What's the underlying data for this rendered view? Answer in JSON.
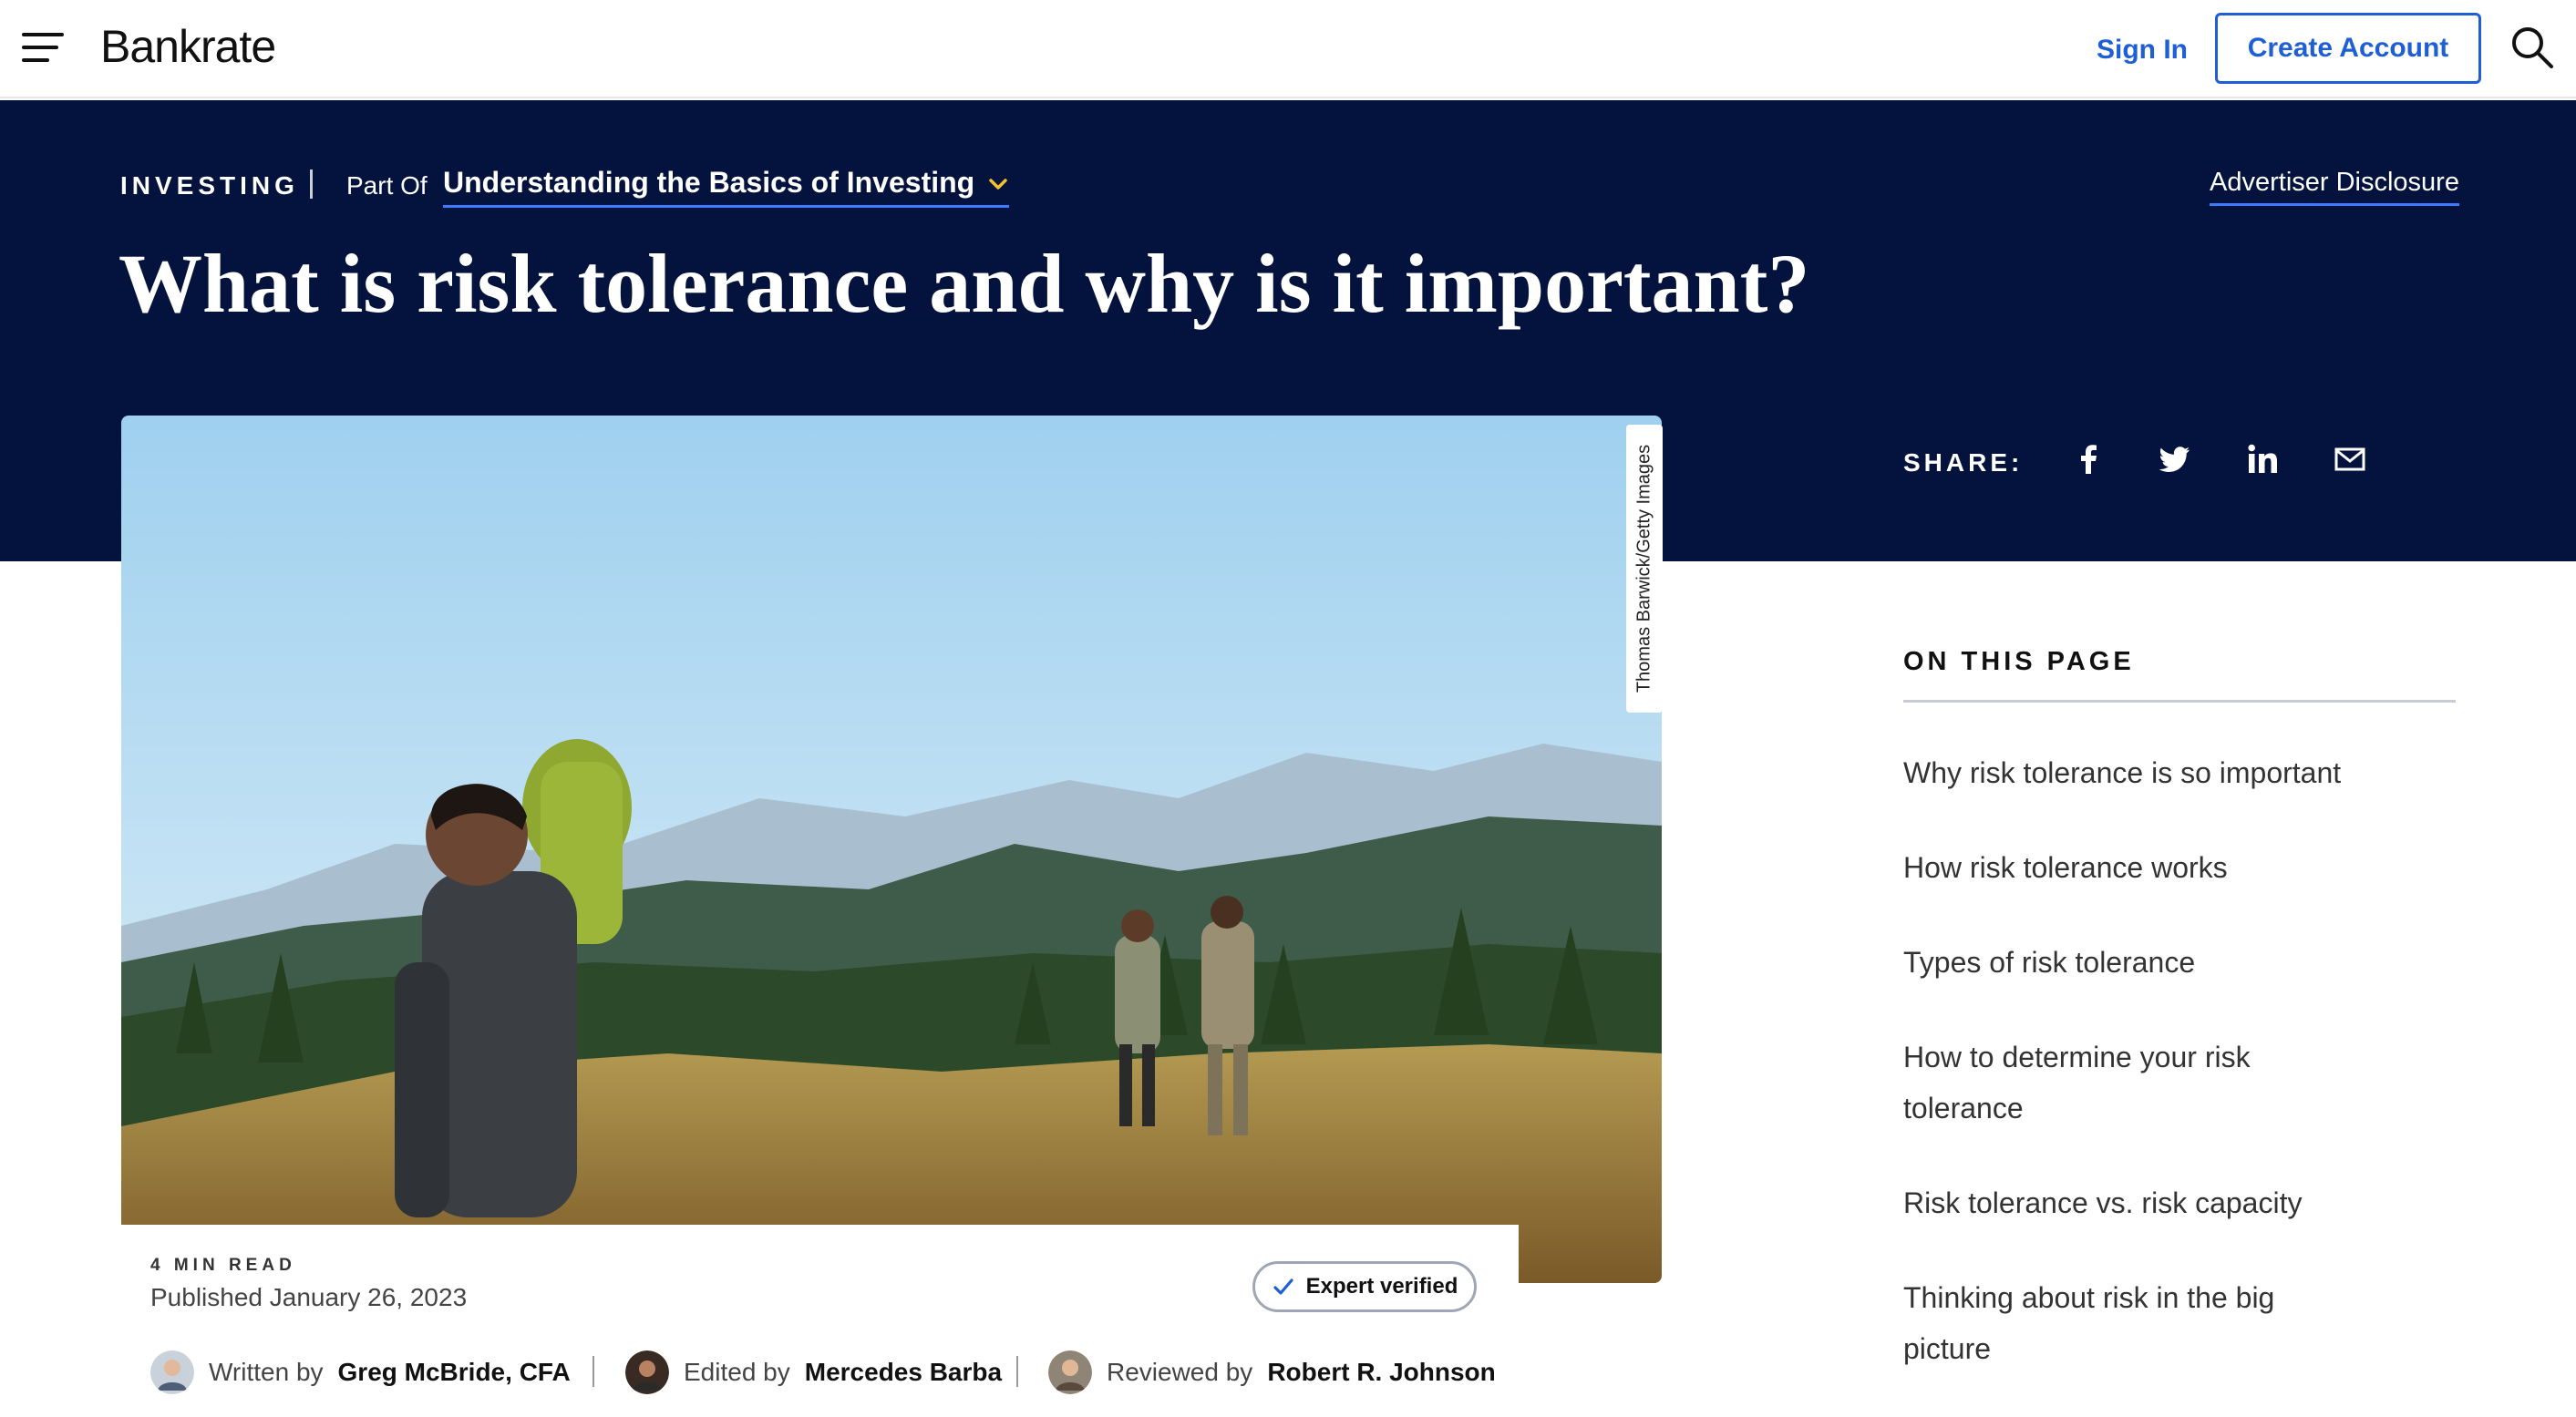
{
  "header": {
    "logo": "Bankrate",
    "sign_in": "Sign In",
    "create_account": "Create Account"
  },
  "hero": {
    "section": "INVESTING",
    "part_of_label": "Part Of",
    "series_title": "Understanding the Basics of Investing",
    "advertiser_disclosure": "Advertiser Disclosure",
    "headline": "What is risk tolerance and why is it important?",
    "share_label": "SHARE:"
  },
  "image": {
    "credit": "Thomas Barwick/Getty Images"
  },
  "meta": {
    "read_time": "4 MIN READ",
    "published": "Published January 26, 2023",
    "verified": "Expert verified",
    "written_prefix": "Written by",
    "writer": "Greg McBride, CFA",
    "edited_prefix": "Edited by",
    "editor": "Mercedes Barba",
    "reviewed_prefix": "Reviewed by",
    "reviewer": "Robert R. Johnson"
  },
  "toc": {
    "title": "ON THIS PAGE",
    "items": [
      "Why risk tolerance is so important",
      "How risk tolerance works",
      "Types of risk tolerance",
      "How to determine your risk tolerance",
      "Risk tolerance vs. risk capacity",
      "Thinking about risk in the big picture"
    ]
  },
  "colors": {
    "navy": "#04133d",
    "link_blue": "#1f5fd6",
    "accent_blue": "#3d7bff",
    "chevron_yellow": "#f2c230"
  },
  "icons": [
    "menu-icon",
    "search-icon",
    "chevron-down-icon",
    "facebook-icon",
    "twitter-icon",
    "linkedin-icon",
    "email-icon",
    "check-icon"
  ]
}
